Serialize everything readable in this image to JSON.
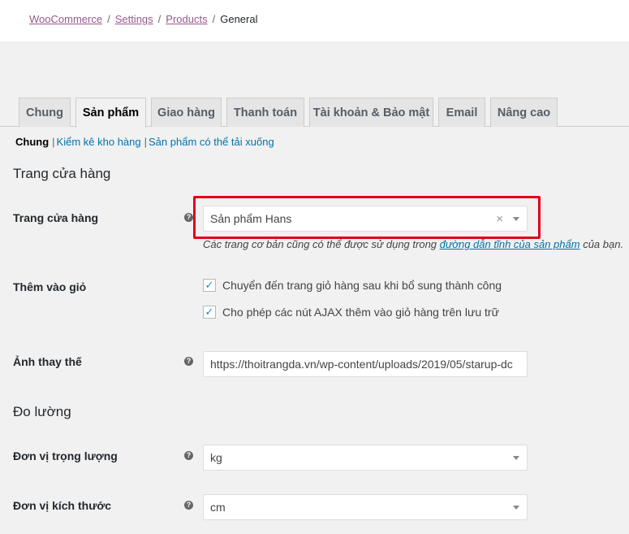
{
  "breadcrumb": {
    "woocommerce": "WooCommerce",
    "sep": "/",
    "settings": "Settings",
    "products": "Products",
    "current": "General"
  },
  "tabs": [
    {
      "label": "Chung"
    },
    {
      "label": "Sản phẩm"
    },
    {
      "label": "Giao hàng"
    },
    {
      "label": "Thanh toán"
    },
    {
      "label": "Tài khoản & Bảo mật"
    },
    {
      "label": "Email"
    },
    {
      "label": "Nâng cao"
    }
  ],
  "subnav": {
    "current": "Chung",
    "sep": "|",
    "inventory": "Kiểm kê kho hàng",
    "downloadable": "Sản phẩm có thể tải xuống"
  },
  "shop": {
    "heading": "Trang cửa hàng",
    "label": "Trang cửa hàng",
    "value": "Sản phẩm Hans",
    "desc_before": "Các trang cơ bản cũng có thể được sử dụng trong ",
    "desc_link": "đường dẫn tĩnh của sản phẩm",
    "desc_after": " của bạn."
  },
  "cart": {
    "label": "Thêm vào giỏ",
    "option1": "Chuyển đến trang giỏ hàng sau khi bổ sung thành công",
    "option2": "Cho phép các nút AJAX thêm vào giỏ hàng trên lưu trữ",
    "option1_checked": true,
    "option2_checked": true
  },
  "placeholder_image": {
    "label": "Ảnh thay thế",
    "value": "https://thoitrangda.vn/wp-content/uploads/2019/05/starup-dc"
  },
  "measure": {
    "heading": "Đo lường",
    "weight_label": "Đơn vị trọng lượng",
    "weight_value": "kg",
    "dimension_label": "Đơn vị kích thước",
    "dimension_value": "cm"
  },
  "icons": {
    "help": "?",
    "clear": "×",
    "check": "✓"
  },
  "colors": {
    "highlight": "#e0001a",
    "link": "#0073aa",
    "woo_link": "#96588a"
  }
}
